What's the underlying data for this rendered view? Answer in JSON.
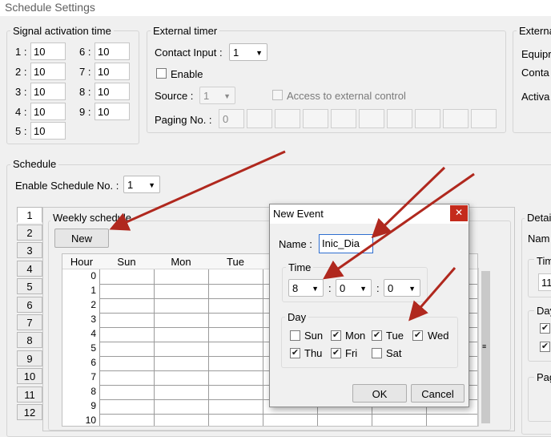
{
  "window": {
    "title": "Schedule Settings"
  },
  "signal": {
    "group_label": "Signal activation time",
    "rows": [
      {
        "label": "1 :",
        "value": "10"
      },
      {
        "label": "2 :",
        "value": "10"
      },
      {
        "label": "3 :",
        "value": "10"
      },
      {
        "label": "4 :",
        "value": "10"
      },
      {
        "label": "5 :",
        "value": "10"
      },
      {
        "label": "6 :",
        "value": "10"
      },
      {
        "label": "7 :",
        "value": "10"
      },
      {
        "label": "8 :",
        "value": "10"
      },
      {
        "label": "9 :",
        "value": "10"
      }
    ]
  },
  "external_timer": {
    "group_label": "External timer",
    "contact_input_label": "Contact Input :",
    "contact_input_value": "1",
    "enable_label": "Enable",
    "source_label": "Source :",
    "source_value": "1",
    "access_label": "Access to external control",
    "paging_label": "Paging No. :",
    "paging_first": "0"
  },
  "external_right": {
    "group_label": "Externa",
    "items": [
      "Equipr",
      "Conta",
      "Activa"
    ]
  },
  "schedule": {
    "group_label": "Schedule",
    "enable_label": "Enable Schedule No. :",
    "enable_value": "1",
    "tabs": [
      "1",
      "2",
      "3",
      "4",
      "5",
      "6",
      "7",
      "8",
      "9",
      "10",
      "11",
      "12"
    ],
    "weekly_label": "Weekly schedule",
    "new_button": "New",
    "grid_headers": [
      "Hour",
      "Sun",
      "Mon",
      "Tue"
    ],
    "hours": [
      "0",
      "1",
      "2",
      "3",
      "4",
      "5",
      "6",
      "7",
      "8",
      "9",
      "10"
    ]
  },
  "details": {
    "group_label": "Detai",
    "name_cut": "Nam",
    "time_cut": "Tim",
    "time_value_cut": "11",
    "day_cut": "Day",
    "page_cut": "Pag"
  },
  "dialog": {
    "title": "New Event",
    "close_glyph": "✕",
    "name_label": "Name :",
    "name_value": "Inic_Dia",
    "time_label": "Time",
    "hour": "8",
    "minute": "0",
    "second": "0",
    "sep": ":",
    "day_label": "Day",
    "days": [
      {
        "label": "Sun",
        "checked": false
      },
      {
        "label": "Mon",
        "checked": true
      },
      {
        "label": "Tue",
        "checked": true
      },
      {
        "label": "Wed",
        "checked": true
      },
      {
        "label": "Thu",
        "checked": true
      },
      {
        "label": "Fri",
        "checked": true
      },
      {
        "label": "Sat",
        "checked": false
      }
    ],
    "ok_label": "OK",
    "cancel_label": "Cancel"
  },
  "colors": {
    "arrow": "#b0281e",
    "close_button": "#c42b1c",
    "accent": "#2f6fd0"
  },
  "icons": {
    "dropdown": "chevron-down-icon",
    "close": "close-icon",
    "check": "checkmark-icon"
  }
}
